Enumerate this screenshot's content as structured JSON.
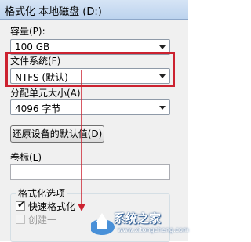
{
  "window": {
    "title": "格式化 本地磁盘 (D:)"
  },
  "capacity": {
    "label": "容量(P):",
    "value": "100 GB"
  },
  "filesystem": {
    "label": "文件系统(F)",
    "value": "NTFS (默认)"
  },
  "allocation": {
    "label": "分配单元大小(A)",
    "value": "4096 字节"
  },
  "restore_button": {
    "label": "还原设备的默认值(D)"
  },
  "volume": {
    "label": "卷标(L)",
    "value": ""
  },
  "format_options": {
    "title": "格式化选项",
    "quick_format": {
      "label": "快速格式化",
      "checked": true
    },
    "create_msdos": {
      "label": "创建一",
      "checked": false,
      "enabled": false
    }
  },
  "watermark": {
    "text": "系统之家",
    "url": "www.xitongcheng.com"
  },
  "colors": {
    "highlight": "#cc2230",
    "arrow": "#cc2230"
  }
}
